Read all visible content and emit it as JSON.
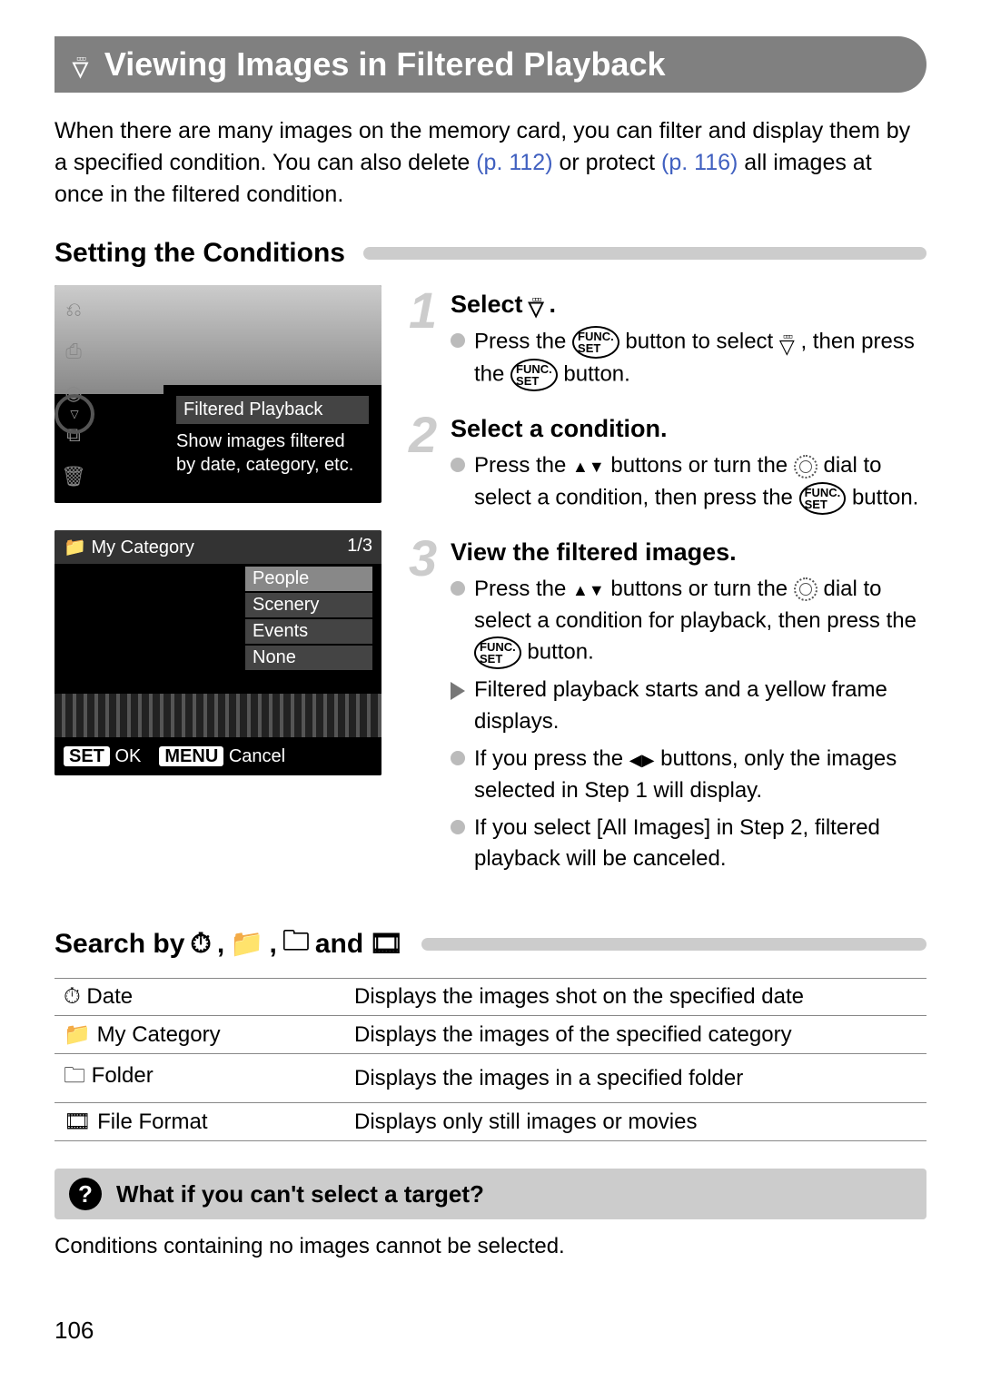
{
  "page_number": "106",
  "title": "Viewing Images in Filtered Playback",
  "intro": {
    "a": "When there are many images on the memory card, you can filter and display them by a specified condition. You can also delete ",
    "link1": "(p. 112)",
    "b": " or protect ",
    "link2": "(p. 116)",
    "c": " all images at once in the filtered condition."
  },
  "subheader1": "Setting the Conditions",
  "screenshot1": {
    "header": "Filtered Playback",
    "body": "Show images filtered by date, category, etc."
  },
  "screenshot2": {
    "title": "My Category",
    "counter": "1/3",
    "items": [
      "People",
      "Scenery",
      "Events",
      "None"
    ],
    "ok_badge": "SET",
    "ok_text": "OK",
    "cancel_badge": "MENU",
    "cancel_text": "Cancel"
  },
  "steps": [
    {
      "num": "1",
      "title": "Select",
      "lines": [
        {
          "type": "dot",
          "text": "Press the |FUNC| button to select |FILTER| , then press the |FUNC| button."
        }
      ]
    },
    {
      "num": "2",
      "title": "Select a condition.",
      "lines": [
        {
          "type": "dot",
          "text": "Press the |UPDOWN| buttons or turn the |DIAL| dial to select a condition, then press the |FUNC| button."
        }
      ]
    },
    {
      "num": "3",
      "title": "View the filtered images.",
      "lines": [
        {
          "type": "dot",
          "text": "Press the |UPDOWN| buttons or turn the |DIAL| dial to select a condition for playback, then press the |FUNC| button."
        },
        {
          "type": "tri",
          "text": "Filtered playback starts and a yellow frame displays."
        },
        {
          "type": "dot",
          "text": "If you press the |LEFTRIGHT| buttons, only the images selected in Step 1 will display."
        },
        {
          "type": "dot",
          "text": "If you select [All Images] in Step 2, filtered playback will be canceled."
        }
      ]
    }
  ],
  "subheader2": {
    "a": "Search by",
    "b": "and"
  },
  "search_table": [
    {
      "icon": "⏱",
      "label": "Date",
      "desc": "Displays the images shot on the specified date"
    },
    {
      "icon": "📁",
      "label": "My Category",
      "desc": "Displays the images of the specified category"
    },
    {
      "icon": "🗀",
      "label": "Folder",
      "desc": "Displays the images in a specified folder"
    },
    {
      "icon": "🎞",
      "label": "File Format",
      "desc": "Displays only still images or movies"
    }
  ],
  "tip": {
    "title": "What if you can't select a target?",
    "body": "Conditions containing no images cannot be selected."
  }
}
